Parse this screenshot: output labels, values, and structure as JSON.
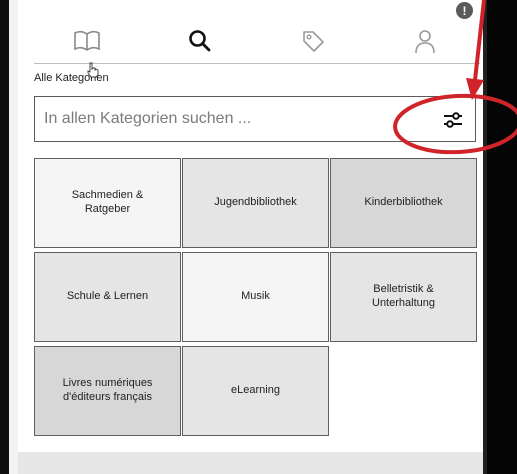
{
  "header": {
    "nav_icons": [
      "book-icon",
      "search-icon",
      "tag-icon",
      "user-icon"
    ],
    "notification_badge": "!"
  },
  "category_label": "Alle Kategorien",
  "search": {
    "placeholder": "In allen Kategorien suchen ..."
  },
  "tiles": [
    {
      "label": "Sachmedien & Ratgeber",
      "shade": "light"
    },
    {
      "label": "Jugendbibliothek",
      "shade": "mid"
    },
    {
      "label": "Kinderbibliothek",
      "shade": "dark"
    },
    {
      "label": "Schule & Lernen",
      "shade": "mid"
    },
    {
      "label": "Musik",
      "shade": "light"
    },
    {
      "label": "Belletristik & Unterhaltung",
      "shade": "mid"
    },
    {
      "label": "Livres numériques d'éditeurs français",
      "shade": "dark"
    },
    {
      "label": "eLearning",
      "shade": "mid"
    }
  ],
  "annotation": {
    "color": "#d1242a"
  }
}
